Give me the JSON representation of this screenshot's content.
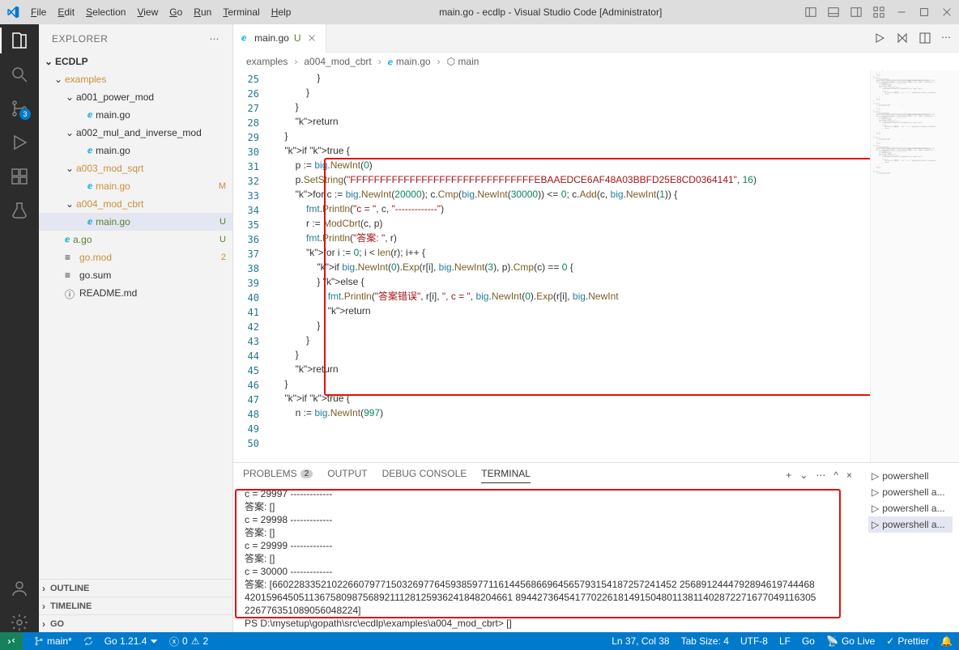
{
  "titlebar": {
    "menus": [
      "File",
      "Edit",
      "Selection",
      "View",
      "Go",
      "Run",
      "Terminal",
      "Help"
    ],
    "title": "main.go - ecdlp - Visual Studio Code [Administrator]"
  },
  "activitybar": {
    "source_control_badge": "3"
  },
  "sidebar": {
    "header": "EXPLORER",
    "root": "ECDLP",
    "tree": [
      {
        "label": "examples",
        "indent": 18,
        "type": "folder-open",
        "deco": "dot"
      },
      {
        "label": "a001_power_mod",
        "indent": 32,
        "type": "folder-open"
      },
      {
        "label": "main.go",
        "indent": 46,
        "type": "go"
      },
      {
        "label": "a002_mul_and_inverse_mod",
        "indent": 32,
        "type": "folder-open"
      },
      {
        "label": "main.go",
        "indent": 46,
        "type": "go"
      },
      {
        "label": "a003_mod_sqrt",
        "indent": 32,
        "type": "folder-open",
        "deco": "dot"
      },
      {
        "label": "main.go",
        "indent": 46,
        "type": "go",
        "deco": "M",
        "decoColor": "#cc8f3b"
      },
      {
        "label": "a004_mod_cbrt",
        "indent": 32,
        "type": "folder-open",
        "deco": "dot",
        "selected": false
      },
      {
        "label": "main.go",
        "indent": 46,
        "type": "go",
        "deco": "U",
        "decoColor": "#588133",
        "selected": true
      },
      {
        "label": "a.go",
        "indent": 18,
        "type": "go",
        "deco": "U",
        "decoColor": "#588133"
      },
      {
        "label": "go.mod",
        "indent": 18,
        "type": "file",
        "deco": "2",
        "decoColor": "#cc8f3b"
      },
      {
        "label": "go.sum",
        "indent": 18,
        "type": "file"
      },
      {
        "label": "README.md",
        "indent": 18,
        "type": "info"
      }
    ],
    "sections": [
      "OUTLINE",
      "TIMELINE",
      "GO"
    ]
  },
  "tab": {
    "name": "main.go",
    "mod": "U"
  },
  "breadcrumbs": [
    "examples",
    "a004_mod_cbrt",
    "main.go",
    "main"
  ],
  "editor": {
    "startLine": 25,
    "lines": [
      "                }",
      "            }",
      "        }",
      "        return",
      "    }",
      "    if true {",
      "        p := big.NewInt(0)",
      "        p.SetString(\"FFFFFFFFFFFFFFFFFFFFFFFFFFFFFFFEBAAEDCE6AF48A03BBFD25E8CD0364141\", 16)",
      "        for c := big.NewInt(20000); c.Cmp(big.NewInt(30000)) <= 0; c.Add(c, big.NewInt(1)) {",
      "            fmt.Println(\"c = \", c, \"-------------\")",
      "            r := ModCbrt(c, p)",
      "            fmt.Println(\"答案: \", r)",
      "            for i := 0; i < len(r); i++ {",
      "                if big.NewInt(0).Exp(r[i], big.NewInt(3), p).Cmp(c) == 0 {",
      "",
      "                } else {",
      "                    fmt.Println(\"答案错误\", r[i], \", c = \", big.NewInt(0).Exp(r[i], big.NewInt",
      "                    return",
      "                }",
      "            }",
      "        }",
      "        return",
      "    }",
      "",
      "    if true {",
      "        n := big.NewInt(997)"
    ]
  },
  "panel": {
    "tabs": [
      "PROBLEMS",
      "OUTPUT",
      "DEBUG CONSOLE",
      "TERMINAL"
    ],
    "problems_badge": "2",
    "terminals": [
      "powershell",
      "powershell  a...",
      "powershell  a...",
      "powershell  a..."
    ],
    "terminal_lines": [
      "c =  29997 -------------",
      "答案:  []",
      "c =  29998 -------------",
      "答案:  []",
      "c =  29999 -------------",
      "答案:  []",
      "c =  30000 -------------",
      "答案:  [66022833521022660797715032697764593859771161445686696456579315418725724145⁠2 2568912444792894619744468",
      "42015964505113675809875689211128125936241848204661 89442736454177022618149150480113811402872271677049116305",
      "2267763510890560482⁠24]",
      "PS D:\\mysetup\\gopath\\src\\ecdlp\\examples\\a004_mod_cbrt> []"
    ]
  },
  "statusbar": {
    "branch": "main*",
    "go": "Go 1.21.4",
    "errors": "0",
    "warnings": "2",
    "pos": "Ln 37, Col 38",
    "tabsize": "Tab Size: 4",
    "encoding": "UTF-8",
    "eol": "LF",
    "lang": "Go",
    "golive": "Go Live",
    "prettier": "Prettier"
  }
}
